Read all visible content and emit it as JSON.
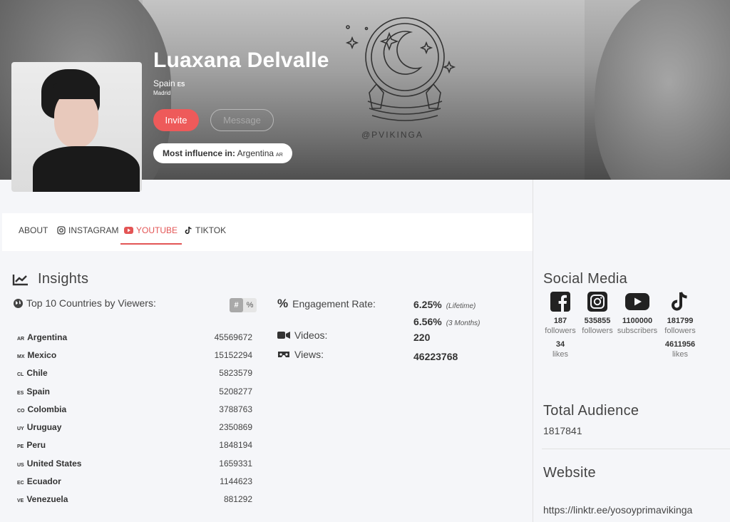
{
  "profile": {
    "name": "Luaxana Delvalle",
    "country": "Spain",
    "country_code": "ES",
    "city": "Madrid",
    "invite_label": "Invite",
    "message_label": "Message",
    "influence_label": "Most influence in:",
    "influence_country": "Argentina",
    "influence_code": "AR"
  },
  "banner": {
    "handle": "@PVIKINGA"
  },
  "tabs": [
    {
      "label": "ABOUT",
      "icon": "none"
    },
    {
      "label": "INSTAGRAM",
      "icon": "instagram-icon"
    },
    {
      "label": "YOUTUBE",
      "icon": "youtube-icon",
      "active": true
    },
    {
      "label": "TIKTOK",
      "icon": "tiktok-icon"
    }
  ],
  "insights": {
    "title": "Insights",
    "top10_label": "Top 10 Countries by Viewers:",
    "toggle": {
      "hash": "#",
      "percent": "%"
    },
    "countries": [
      {
        "code": "AR",
        "name": "Argentina",
        "value": "45569672"
      },
      {
        "code": "MX",
        "name": "Mexico",
        "value": "15152294"
      },
      {
        "code": "CL",
        "name": "Chile",
        "value": "5823579"
      },
      {
        "code": "ES",
        "name": "Spain",
        "value": "5208277"
      },
      {
        "code": "CO",
        "name": "Colombia",
        "value": "3788763"
      },
      {
        "code": "UY",
        "name": "Uruguay",
        "value": "2350869"
      },
      {
        "code": "PE",
        "name": "Peru",
        "value": "1848194"
      },
      {
        "code": "US",
        "name": "United States",
        "value": "1659331"
      },
      {
        "code": "EC",
        "name": "Ecuador",
        "value": "1144623"
      },
      {
        "code": "VE",
        "name": "Venezuela",
        "value": "881292"
      }
    ],
    "engagement_label": "Engagement Rate:",
    "engagement_lifetime": "6.25%",
    "engagement_lifetime_note": "(Lifetime)",
    "engagement_3m": "6.56%",
    "engagement_3m_note": "(3 Months)",
    "videos_label": "Videos:",
    "videos_value": "220",
    "views_label": "Views:",
    "views_value": "46223768"
  },
  "social_media": {
    "title": "Social Media",
    "networks": [
      {
        "icon": "facebook-icon",
        "count": "187",
        "unit": "followers",
        "likes": "34",
        "likes_unit": "likes"
      },
      {
        "icon": "instagram-icon",
        "count": "535855",
        "unit": "followers"
      },
      {
        "icon": "youtube-icon",
        "count": "1100000",
        "unit": "subscribers"
      },
      {
        "icon": "tiktok-icon",
        "count": "181799",
        "unit": "followers",
        "likes": "4611956",
        "likes_unit": "likes"
      }
    ]
  },
  "total_audience": {
    "title": "Total Audience",
    "value": "1817841"
  },
  "website": {
    "title": "Website",
    "value": "https://linktr.ee/yosoyprimavikinga"
  },
  "colors": {
    "accent": "#e35555",
    "invite_bg": "#ee5a5a"
  }
}
